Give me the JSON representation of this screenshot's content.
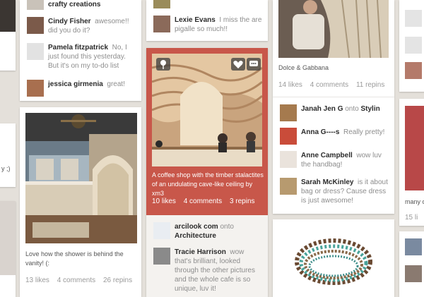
{
  "col1": {
    "comments": [
      {
        "name": "Cindy Fisher",
        "text": "awesome!! did you do it?"
      },
      {
        "name": "Pamela fitzpatrick",
        "text": "No, I just found this yesterday. But it's on my to-do list"
      },
      {
        "name": "jessica girmenia",
        "text": "great!"
      }
    ],
    "top_text": "crafty creations",
    "pin": {
      "description": "Love how the shower is behind the vanity! (:",
      "likes": "13 likes",
      "comments": "4 comments",
      "repins": "26 repins"
    }
  },
  "col2": {
    "top_name": "Lexie Evans",
    "top_text": "I miss the are pigalle so much!!",
    "pin": {
      "description": "A coffee shop with the timber stalactites of an undulating cave-like ceiling by xm3",
      "likes": "10 likes",
      "comments": "4 comments",
      "repins": "3 repins"
    },
    "source": {
      "name": "arcilook com",
      "onto": "onto",
      "board": "Architecture"
    },
    "comment": {
      "name": "Tracie Harrison",
      "text": "wow that's brilliant, looked through the other pictures and the whole cafe is so unique, luv it!"
    }
  },
  "col3": {
    "pin": {
      "description": "Dolce & Gabbana",
      "likes": "14 likes",
      "comments": "4 comments",
      "repins": "11 repins"
    },
    "source": {
      "name": "Janah Jen G",
      "onto": "onto",
      "board": "Stylin"
    },
    "comments": [
      {
        "name": "Anna G----s",
        "text": "Really pretty!"
      },
      {
        "name": "Anne Campbell",
        "text": "wow luv the handbag!"
      },
      {
        "name": "Sarah McKinley",
        "text": "is it about bag or dress? Cause dress is just awesome!"
      }
    ]
  },
  "col4": {
    "snippet": "many c",
    "count": "15 li"
  },
  "col0": {
    "snippet": "y ;)"
  },
  "icons": {
    "heart": "heart-icon",
    "comment": "comment-icon",
    "pin": "pin-icon"
  }
}
